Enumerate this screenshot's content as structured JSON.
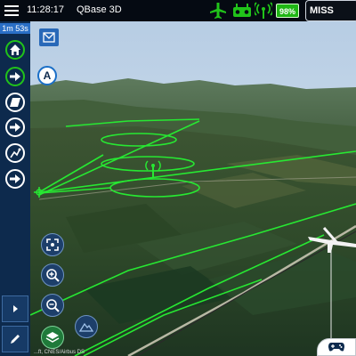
{
  "topbar": {
    "menu_icon": "hamburger-icon",
    "clock": "11:28:17",
    "app_name": "QBase 3D",
    "status_icons": [
      "airplane-icon",
      "remote-controller-icon",
      "signal-icon"
    ],
    "battery": "98%",
    "mission_button": "MISS",
    "status_color": "#21c31a"
  },
  "sidebar": {
    "timer": "1m 53s",
    "buttons": [
      {
        "name": "home-button",
        "icon": "home-icon"
      },
      {
        "name": "forward-button",
        "icon": "arrow-right-icon"
      },
      {
        "name": "land-button",
        "icon": "land-icon"
      },
      {
        "name": "next-button",
        "icon": "arrow-right-icon"
      },
      {
        "name": "path-button",
        "icon": "waypoint-path-icon"
      },
      {
        "name": "next-step-button",
        "icon": "arrow-right-icon"
      }
    ],
    "bottom_buttons": [
      {
        "name": "expand-button",
        "icon": "chevron-right-icon"
      },
      {
        "name": "edit-button",
        "icon": "pencil-icon"
      }
    ],
    "accent": "#2a6fc6"
  },
  "map": {
    "message_icon": "envelope-icon",
    "waypoint_marker": "A",
    "tool_buttons": [
      "fit-view-icon",
      "zoom-in-icon",
      "zoom-out-icon",
      "layers-icon",
      "terrain-icon"
    ],
    "attribution": "...ft, CNES/Airbus DS",
    "flight_path_color": "#27e832",
    "gamepad_icon": "gamepad-icon"
  }
}
